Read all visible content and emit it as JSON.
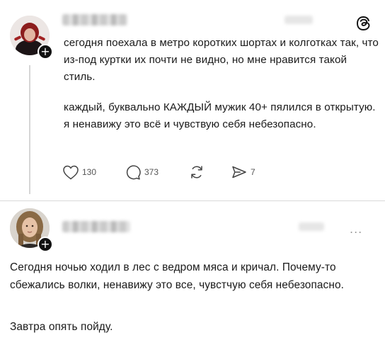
{
  "post1": {
    "avatar_icon": "avatar-red-hair-woman",
    "paragraph1": "сегодня поехала в метро коротких шортах и колготках так, что из-под куртки их почти не видно, но мне нравится такой стиль.",
    "paragraph2": "каждый, буквально КАЖДЫЙ мужик 40+ пялился в открытую. я ненавижу это всё и чувствую себя небезопасно.",
    "likes": "130",
    "comments": "373",
    "shares": "7"
  },
  "post2": {
    "avatar_icon": "avatar-long-hair-man",
    "paragraph1": "Сегодня ночью ходил в лес с ведром мяса и кричал. Почему-то сбежались волки, ненавижу это все, чувстчую себя небезопасно.",
    "paragraph2": "Завтра опять пойду.",
    "more_label": "..."
  },
  "badge_symbol": "+",
  "brand_icon": "threads-logo-icon"
}
